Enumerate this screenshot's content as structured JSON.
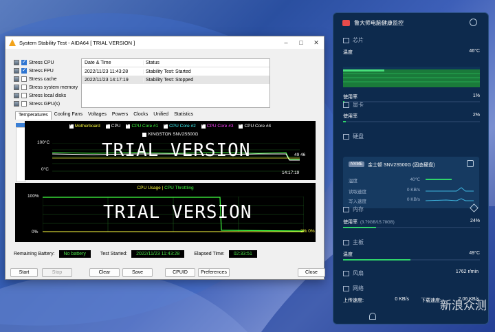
{
  "aida": {
    "title": "System Stability Test - AIDA64  [ TRIAL VERSION ]",
    "stress": [
      {
        "label": "Stress CPU",
        "checked": true
      },
      {
        "label": "Stress FPU",
        "checked": true
      },
      {
        "label": "Stress cache",
        "checked": false
      },
      {
        "label": "Stress system memory",
        "checked": false
      },
      {
        "label": "Stress local disks",
        "checked": false
      },
      {
        "label": "Stress GPU(s)",
        "checked": false
      }
    ],
    "log_headers": [
      "Date & Time",
      "Status"
    ],
    "log_rows": [
      {
        "time": "2022/11/23 11:43:28",
        "status": "Stability Test: Started"
      },
      {
        "time": "2022/11/23 14:17:19",
        "status": "Stability Test: Stopped"
      }
    ],
    "tabs": [
      "Temperatures",
      "Cooling Fans",
      "Voltages",
      "Powers",
      "Clocks",
      "Unified",
      "Statistics"
    ],
    "graph1": {
      "legend": [
        {
          "label": "Motherboard",
          "color": "#ffff40"
        },
        {
          "label": "CPU",
          "color": "#ffffff"
        },
        {
          "label": "CPU Core #1",
          "color": "#40ff40"
        },
        {
          "label": "CPU Core #2",
          "color": "#40ffff"
        },
        {
          "label": "CPU Core #3",
          "color": "#ff40ff"
        },
        {
          "label": "CPU Core #4",
          "color": "#ffffff"
        }
      ],
      "sub_legend": "KINGSTON SNV2S500G",
      "y_top": "100°C",
      "y_bottom": "0°C",
      "time": "14:17:19",
      "end_values": "49 46",
      "watermark": "TRIAL VERSION"
    },
    "graph2": {
      "title_a": "CPU Usage",
      "title_sep": " | ",
      "title_b": "CPU Throttling",
      "y_top": "100%",
      "y_bottom": "0%",
      "end_values": "2% 0%",
      "watermark": "TRIAL VERSION"
    },
    "remaining_battery_label": "Remaining Battery:",
    "remaining_battery": "No battery",
    "test_started_label": "Test Started:",
    "test_started": "2022/11/23 11:43:28",
    "elapsed_label": "Elapsed Time:",
    "elapsed": "02:33:51",
    "buttons": {
      "start": "Start",
      "stop": "Stop",
      "clear": "Clear",
      "save": "Save",
      "cpuid": "CPUID",
      "preferences": "Preferences",
      "close": "Close"
    }
  },
  "monitor": {
    "title": "鲁大师电脑健康监控",
    "chip": {
      "header": "芯片",
      "temp_label": "温度",
      "temp": "46°C",
      "usage_label": "使用率",
      "usage": "1%",
      "usage_fraction": 0.01
    },
    "gpu": {
      "header": "显卡",
      "usage_label": "使用率",
      "usage": "2%",
      "usage_fraction": 0.02
    },
    "disk": {
      "header": "硬盘",
      "badge": "NVME",
      "name": "金士顿 SNV2S500G (固态硬盘)",
      "temp_label": "温度",
      "temp": "40℃",
      "read_label": "读取速度",
      "read": "0 KB/s",
      "write_label": "写入速度",
      "write": "0 KB/s"
    },
    "memory": {
      "header": "内存",
      "usage_label": "使用率",
      "detail": "(3.79GB/15.78GB)",
      "usage": "24%",
      "usage_fraction": 0.24
    },
    "board": {
      "header": "主板",
      "temp_label": "温度",
      "temp": "49°C",
      "temp_fraction": 0.49
    },
    "fan": {
      "header": "风扇",
      "speed": "1762 r/min"
    },
    "network": {
      "header": "网络",
      "up_label": "上传速度:",
      "up": "0 KB/s",
      "down_label": "下载速度:",
      "down": "2.06 KB/s"
    }
  },
  "watermark_text": "新浪众测"
}
